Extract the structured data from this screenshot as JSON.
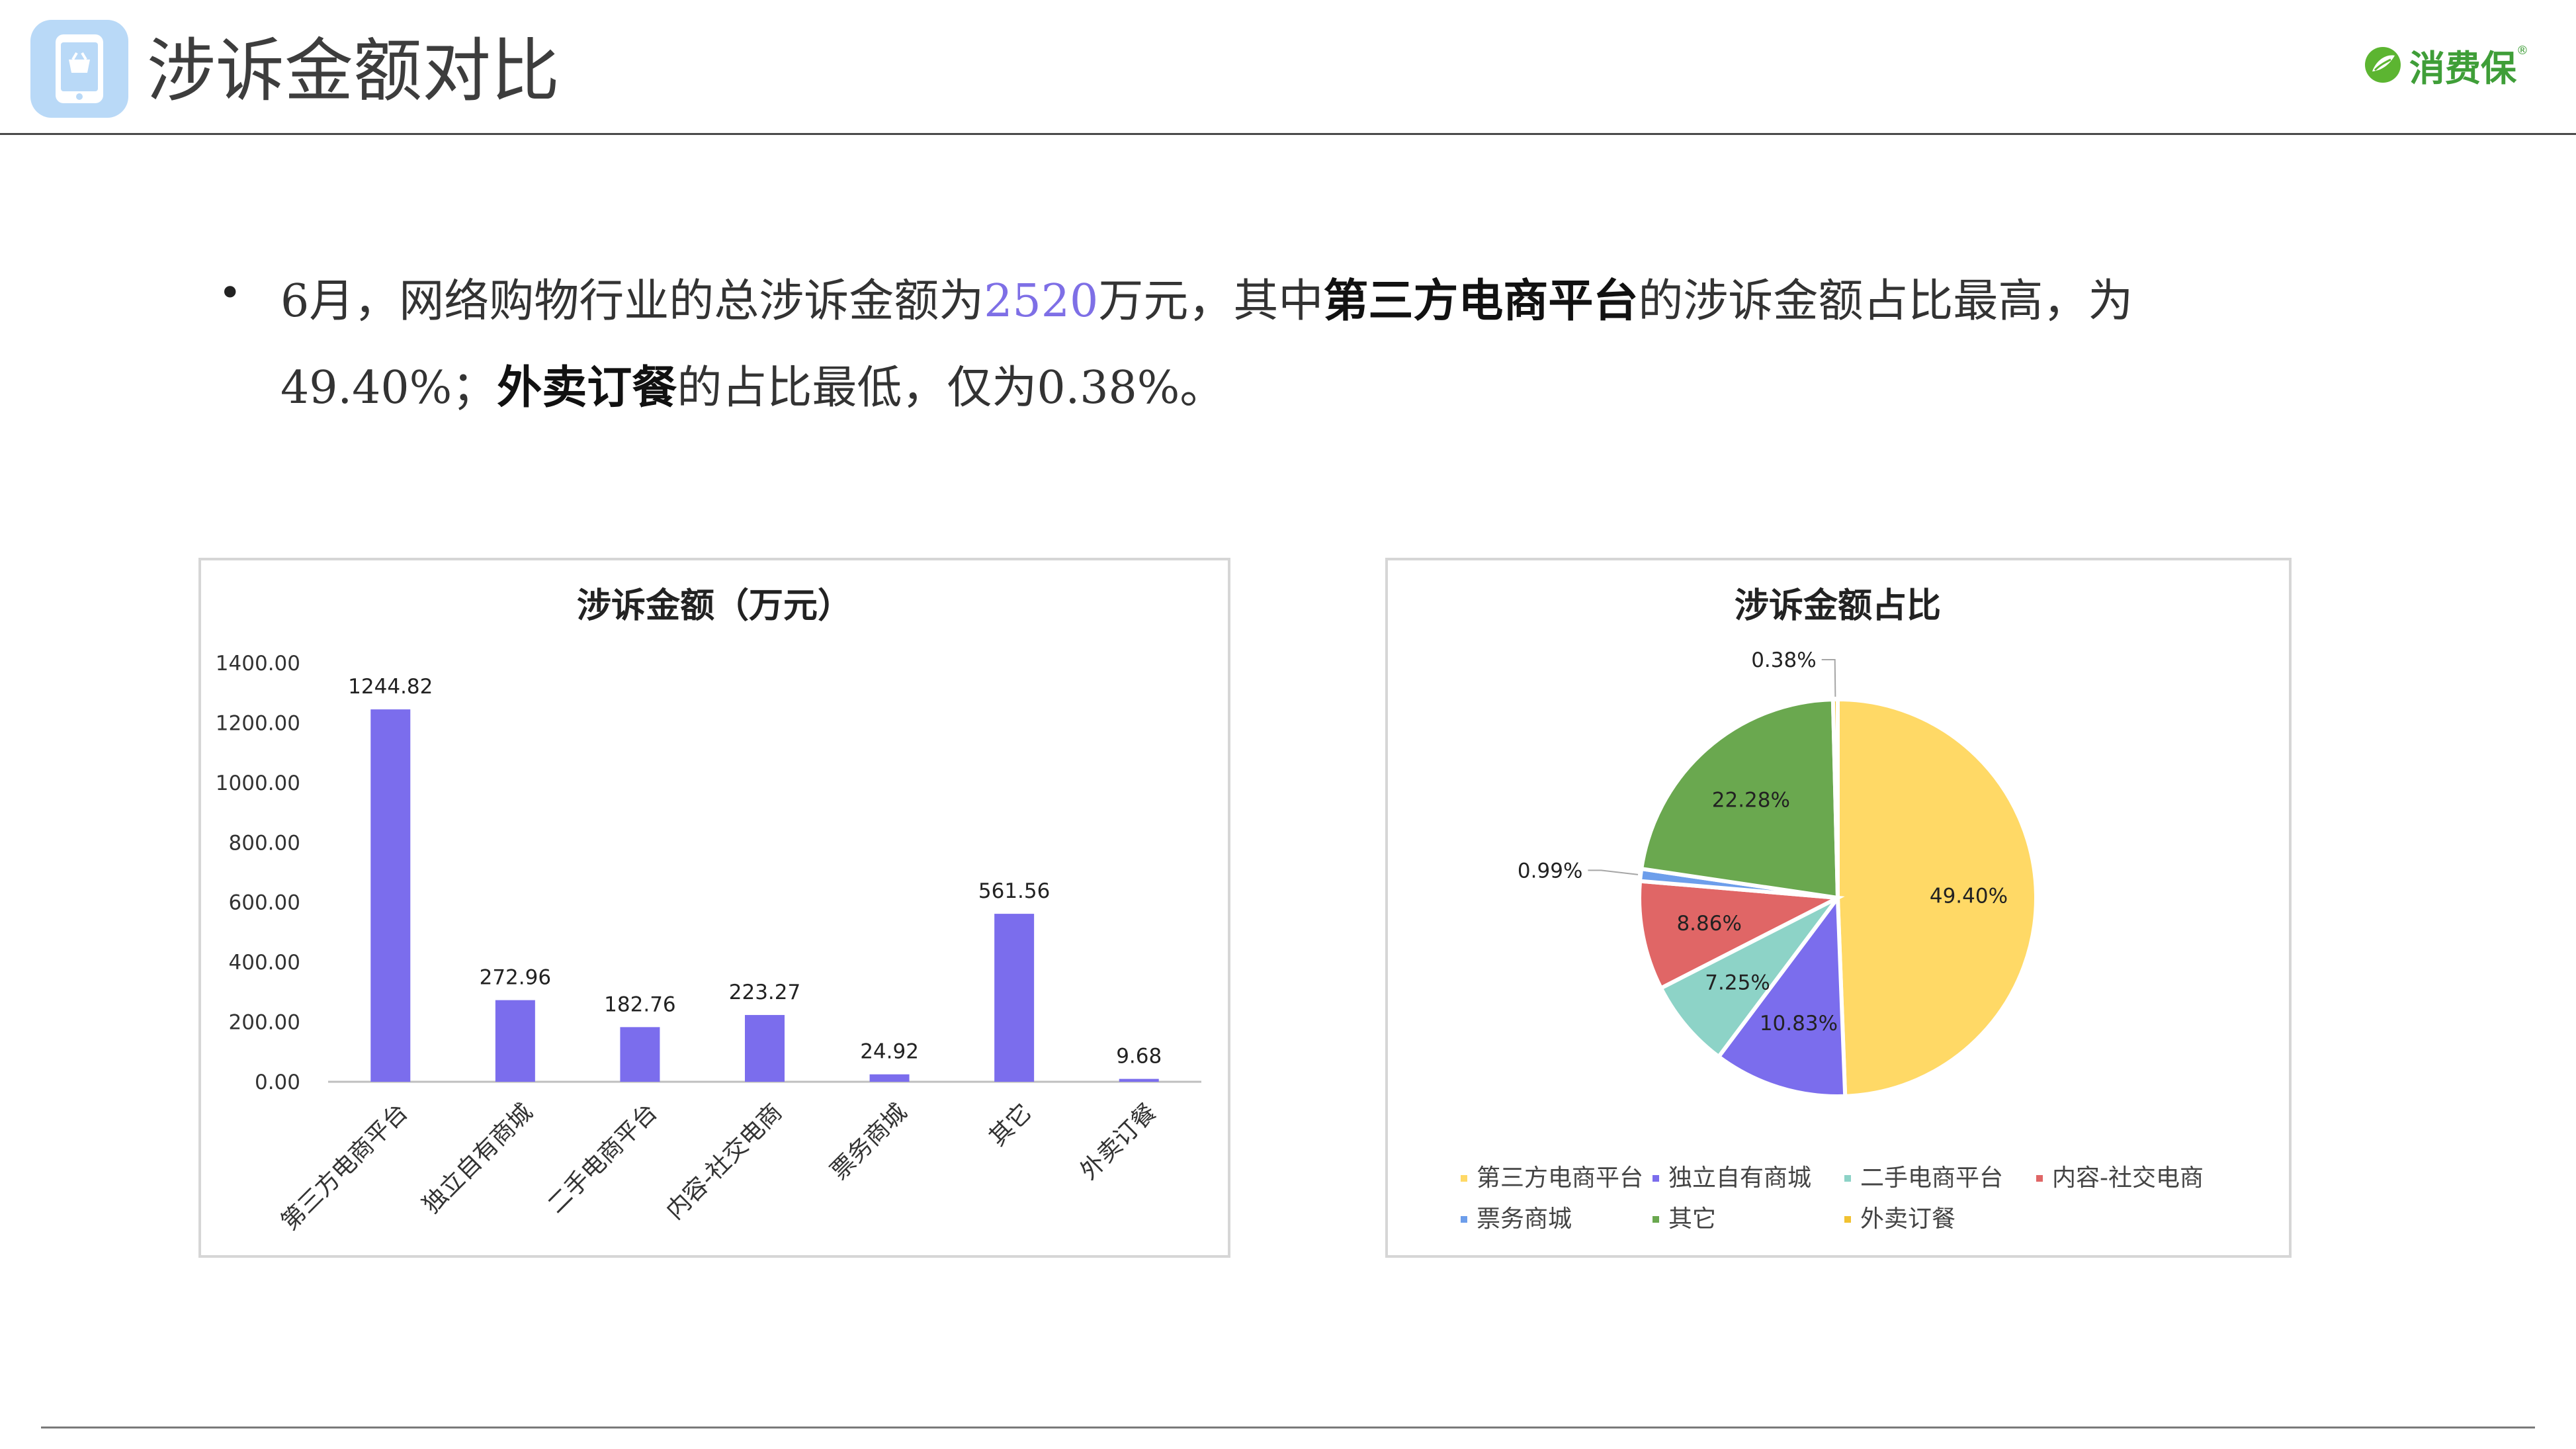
{
  "header": {
    "title": "涉诉金额对比",
    "logo_text": "消费保",
    "logo_mark": "®",
    "icon": "shopping-tablet-icon"
  },
  "summary": {
    "bullet": "•",
    "seg1": "6月，网络购物行业的总涉诉金额为",
    "total": "2520",
    "seg2": "万元，其中",
    "top_name": "第三方电商平台",
    "seg3": "的涉诉金额占比最高，为49.40%；",
    "low_name": "外卖订餐",
    "seg4": "的占比最低，仅为0.38%。",
    "highlight_color": "#7e6fe6"
  },
  "chart_data": [
    {
      "type": "bar",
      "title": "涉诉金额（万元）",
      "categories": [
        "第三方电商平台",
        "独立自有商城",
        "二手电商平台",
        "内容-社交电商",
        "票务商城",
        "其它",
        "外卖订餐"
      ],
      "values": [
        1244.82,
        272.96,
        182.76,
        223.27,
        24.92,
        561.56,
        9.68
      ],
      "value_labels": [
        "1244.82",
        "272.96",
        "182.76",
        "223.27",
        "24.92",
        "561.56",
        "9.68"
      ],
      "yticks": [
        "0.00",
        "200.00",
        "400.00",
        "600.00",
        "800.00",
        "1000.00",
        "1200.00",
        "1400.00"
      ],
      "ylim": [
        0,
        1400
      ],
      "bar_color": "#7b6ded",
      "grid": false,
      "legend": "none"
    },
    {
      "type": "pie",
      "title": "涉诉金额占比",
      "categories": [
        "第三方电商平台",
        "独立自有商城",
        "二手电商平台",
        "内容-社交电商",
        "票务商城",
        "其它",
        "外卖订餐"
      ],
      "values": [
        49.4,
        10.83,
        7.25,
        8.86,
        0.99,
        22.28,
        0.38
      ],
      "value_labels": [
        "49.40%",
        "10.83%",
        "7.25%",
        "8.86%",
        "0.99%",
        "22.28%",
        "0.38%"
      ],
      "colors": [
        "#ffd966",
        "#7b6ded",
        "#8dd3c7",
        "#e06666",
        "#6d9eeb",
        "#6aa84f",
        "#f1c232"
      ],
      "legend": "bottom"
    }
  ]
}
